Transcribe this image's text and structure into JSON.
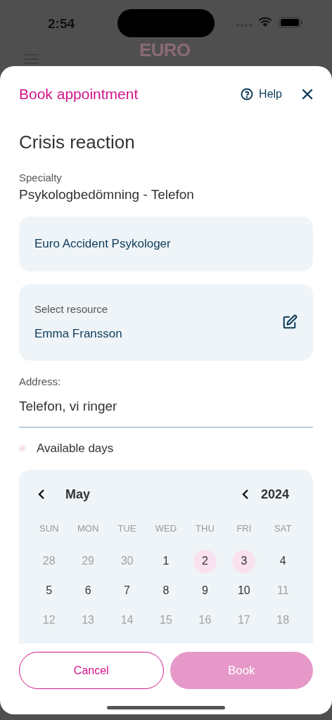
{
  "status_bar": {
    "time": "2:54"
  },
  "background": {
    "logo": "EURO"
  },
  "sheet": {
    "title": "Book appointment",
    "help": "Help",
    "heading": "Crisis reaction",
    "specialty": {
      "label": "Specialty",
      "value": "Psykologbedömning - Telefon"
    },
    "provider": "Euro Accident Psykologer",
    "resource": {
      "label": "Select resource",
      "value": "Emma Fransson"
    },
    "address": {
      "label": "Address:",
      "value": "Telefon, vi ringer"
    },
    "legend": {
      "label": "Available days",
      "color": "#f9e1ef"
    },
    "calendar": {
      "month": "May",
      "year": "2024",
      "weekdays": [
        "SUN",
        "MON",
        "TUE",
        "WED",
        "THU",
        "FRI",
        "SAT"
      ],
      "days": [
        {
          "label": "28",
          "muted": true,
          "available": false
        },
        {
          "label": "29",
          "muted": true,
          "available": false
        },
        {
          "label": "30",
          "muted": true,
          "available": false
        },
        {
          "label": "1",
          "muted": false,
          "available": false
        },
        {
          "label": "2",
          "muted": false,
          "available": true
        },
        {
          "label": "3",
          "muted": false,
          "available": true
        },
        {
          "label": "4",
          "muted": false,
          "available": false
        },
        {
          "label": "5",
          "muted": false,
          "available": false
        },
        {
          "label": "6",
          "muted": false,
          "available": false
        },
        {
          "label": "7",
          "muted": false,
          "available": false
        },
        {
          "label": "8",
          "muted": false,
          "available": false
        },
        {
          "label": "9",
          "muted": false,
          "available": false
        },
        {
          "label": "10",
          "muted": false,
          "available": false
        },
        {
          "label": "11",
          "muted": true,
          "available": false
        },
        {
          "label": "12",
          "muted": true,
          "available": false
        },
        {
          "label": "13",
          "muted": true,
          "available": false
        },
        {
          "label": "14",
          "muted": true,
          "available": false
        },
        {
          "label": "15",
          "muted": true,
          "available": false
        },
        {
          "label": "16",
          "muted": true,
          "available": false
        },
        {
          "label": "17",
          "muted": true,
          "available": false
        },
        {
          "label": "18",
          "muted": true,
          "available": false
        }
      ]
    },
    "buttons": {
      "cancel": "Cancel",
      "book": {
        "label": "Book",
        "disabled": true
      }
    }
  }
}
